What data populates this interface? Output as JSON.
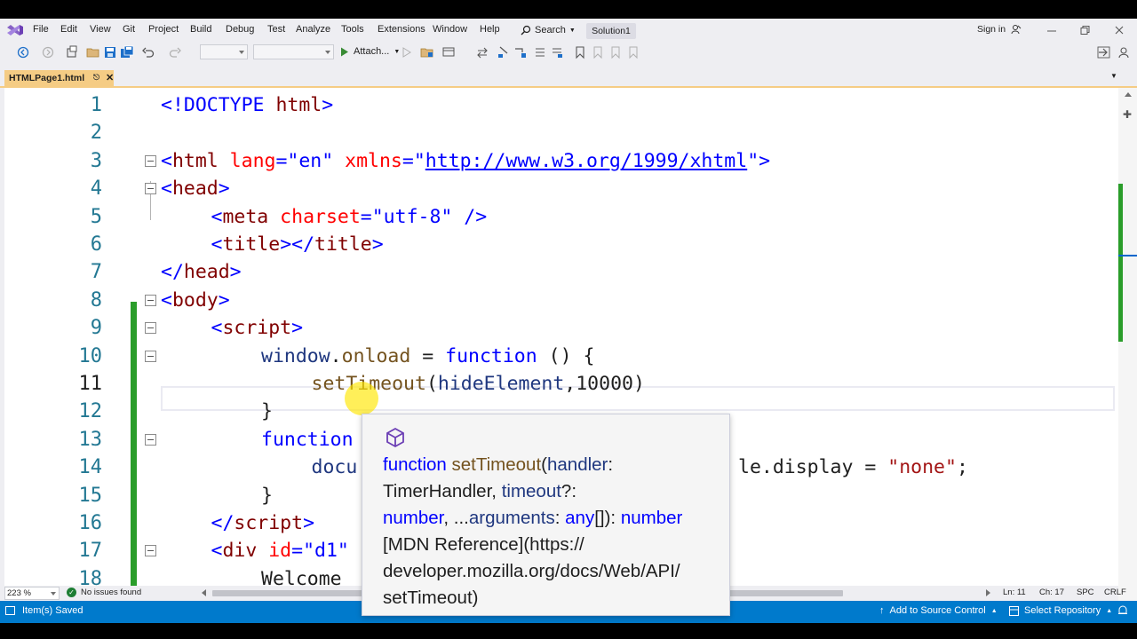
{
  "menu": {
    "items": [
      "File",
      "Edit",
      "View",
      "Git",
      "Project",
      "Build",
      "Debug",
      "Test",
      "Analyze",
      "Tools",
      "Extensions",
      "Window",
      "Help"
    ],
    "search_label": "Search",
    "solution_name": "Solution1",
    "sign_in": "Sign in"
  },
  "toolbar": {
    "attach_label": "Attach..."
  },
  "tab": {
    "name": "HTMLPage1.html"
  },
  "editor": {
    "current_line": 11,
    "lines": [
      {
        "num": "1"
      },
      {
        "num": "2"
      },
      {
        "num": "3"
      },
      {
        "num": "4"
      },
      {
        "num": "5"
      },
      {
        "num": "6"
      },
      {
        "num": "7"
      },
      {
        "num": "8"
      },
      {
        "num": "9"
      },
      {
        "num": "10"
      },
      {
        "num": "11"
      },
      {
        "num": "12"
      },
      {
        "num": "13"
      },
      {
        "num": "14"
      },
      {
        "num": "15"
      },
      {
        "num": "16"
      },
      {
        "num": "17"
      },
      {
        "num": "18"
      }
    ],
    "code": {
      "l1": {
        "a": "<!DOCTYPE",
        "b": " html",
        "c": ">"
      },
      "l3": {
        "a": "<",
        "b": "html",
        "c": " lang",
        "d": "=\"en\"",
        "e": " xmlns",
        "f": "=\"",
        "g": "http://www.w3.org/1999/xhtml",
        "h": "\">"
      },
      "l4": {
        "a": "<",
        "b": "head",
        "c": ">"
      },
      "l5": {
        "a": "<",
        "b": "meta",
        "c": " charset",
        "d": "=\"utf-8\"",
        "e": " />"
      },
      "l6": {
        "a": "<",
        "b": "title",
        "c": "></",
        "d": "title",
        "e": ">"
      },
      "l7": {
        "a": "</",
        "b": "head",
        "c": ">"
      },
      "l8": {
        "a": "<",
        "b": "body",
        "c": ">"
      },
      "l9": {
        "a": "<",
        "b": "script",
        "c": ">"
      },
      "l10": {
        "a": "window",
        "b": ".",
        "c": "onload",
        "d": " = ",
        "e": "function",
        "f": " () {"
      },
      "l11": {
        "a": "setTimeout",
        "b": "(",
        "c": "hideElement",
        "d": ",10000)"
      },
      "l12": {
        "a": "}"
      },
      "l13": {
        "a": "function"
      },
      "l14": {
        "a": "docu",
        "b": "le.display = ",
        "c": "\"none\"",
        "d": ";"
      },
      "l15": {
        "a": "}"
      },
      "l16": {
        "a": "</",
        "b": "script",
        "c": ">"
      },
      "l17": {
        "a": "<",
        "b": "div",
        "c": " id",
        "d": "=\"d1\""
      },
      "l18": {
        "a": "Welcome"
      }
    }
  },
  "quickinfo": {
    "kw": "function",
    "fn": "setTimeout",
    "p1": "(",
    "handler": "handler",
    "colon1": ":",
    "handler_type": "TimerHandler",
    "comma1": ", ",
    "timeout": "timeout",
    "q": "?:",
    "number1": "number",
    "comma2": ", ...",
    "arguments": "arguments",
    "colon2": ": ",
    "any": "any",
    "arr": "[]): ",
    "number2": "number",
    "doc_line1": "[MDN Reference](https://",
    "doc_line2": "developer.mozilla.org/docs/Web/API/",
    "doc_line3": "setTimeout)"
  },
  "editor_status": {
    "zoom": "223 %",
    "issues": "No issues found",
    "line": "Ln: 11",
    "char": "Ch: 17",
    "spacing": "SPC",
    "eol": "CRLF"
  },
  "statusbar": {
    "saved": "Item(s) Saved",
    "source_control": "Add to Source Control",
    "select_repo": "Select Repository"
  },
  "colors": {
    "accent": "#007acc",
    "tab_active": "#f5cc84",
    "change_bar": "#2a9d2a"
  }
}
